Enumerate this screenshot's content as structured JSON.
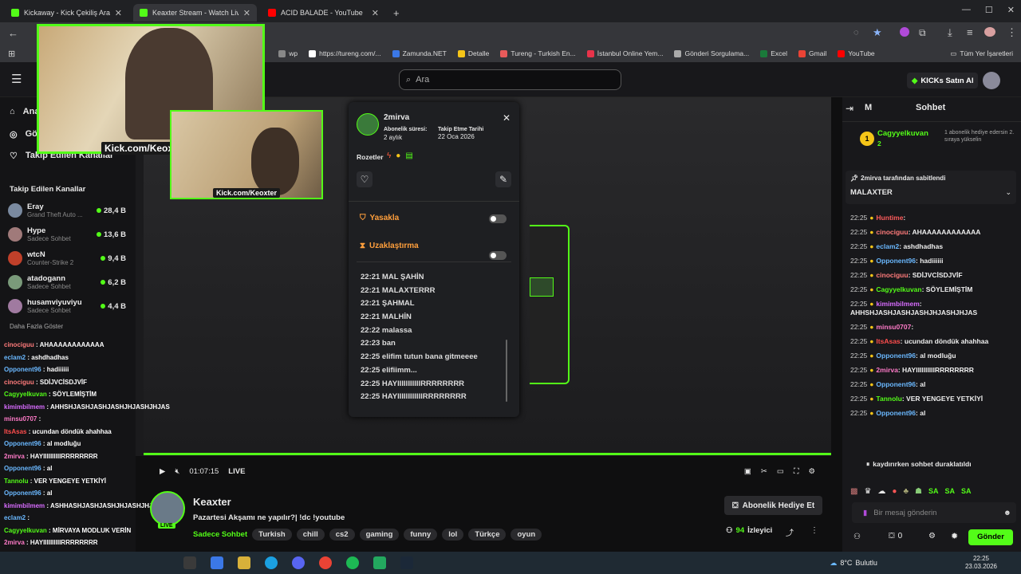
{
  "tabs": [
    {
      "title": "Kickaway - Kick Çekiliş Aracı",
      "color": "#53fc18",
      "active": false
    },
    {
      "title": "Keaxter Stream - Watch Live o",
      "color": "#53fc18",
      "active": true
    },
    {
      "title": "ACID BALADE - YouTube",
      "color": "#ff0000",
      "active": false
    }
  ],
  "bookmarks": [
    "wp",
    "https://tureng.com/...",
    "Zamunda.NET",
    "Detalle",
    "Tureng - Turkish En...",
    "İstanbul Online Yem...",
    "Gönderi Sorgulama...",
    "Excel",
    "Gmail",
    "YouTube"
  ],
  "bookmarks_other": "Tüm Yer İşaretleri",
  "header": {
    "search_placeholder": "Ara",
    "buy_kicks": "KICKs Satın Al"
  },
  "leftnav": {
    "partial1": "Ana",
    "partial2": "Göz",
    "following_link": "Takip Edilen Kanallar",
    "following_title": "Takip Edilen Kanallar",
    "channels": [
      {
        "name": "Eray",
        "sub": "Grand Theft Auto ...",
        "count": "28,4 B"
      },
      {
        "name": "Hype",
        "sub": "Sadece Sohbet",
        "count": "13,6 B"
      },
      {
        "name": "wtcN",
        "sub": "Counter-Strike 2",
        "count": "9,4 B"
      },
      {
        "name": "atadogann",
        "sub": "Sadece Sohbet",
        "count": "6,2 B"
      },
      {
        "name": "husamviyuviyu",
        "sub": "Sadece Sohbet",
        "count": "4,4 B"
      }
    ],
    "more": "Daha Fazla Göster"
  },
  "webcam": {
    "label1": "Kick.com/Keoxter",
    "label2": "Kick.com/Keoxter"
  },
  "popup": {
    "username": "2mirva",
    "sub_label": "Abonelik süresi:",
    "sub_value": "2 aylık",
    "follow_label": "Takip Etme Tarihi",
    "follow_value": "22 Oca 2026",
    "badges_label": "Rozetler",
    "ban_label": "Yasakla",
    "timeout_label": "Uzaklaştırma",
    "messages": [
      "22:21 MAL ŞAHİN",
      "22:21 MALAXTERRR",
      "22:21 ŞAHMAL",
      "22:21 MALHİN",
      "22:22 malassa",
      "22:23 ban",
      "22:25 elifim tutun bana gitmeeee",
      "22:25 elifiimm...",
      "22:25 HAYIIIIIIIIIIIRRRRRRRR",
      "22:25 HAYIIIIIIIIIIIIRRRRRRRR"
    ]
  },
  "player": {
    "time": "01:07:15",
    "live": "LIVE"
  },
  "stream": {
    "streamer": "Keaxter",
    "title": "Pazartesi Akşamı ne yapılır?| !dc !youtube",
    "category": "Sadece Sohbet",
    "tags": [
      "Turkish",
      "chill",
      "cs2",
      "gaming",
      "funny",
      "lol",
      "Türkçe",
      "oyun"
    ],
    "gift_button": "Abonelik Hediye Et",
    "viewers": "94",
    "viewers_label": "İzleyici",
    "live_badge": "LIVE"
  },
  "chat": {
    "title": "Sohbet",
    "left_icon_label": "M",
    "top_gifter": "Cagyyelkuvan",
    "top_gifter_count": "2",
    "top_gifter_desc": "1 abonelik hediye edersin 2. sıraya yükselin",
    "pinned_by": "2mirva tarafından sabitlendi",
    "pinned_text": "MALAXTER",
    "messages": [
      {
        "time": "22:25",
        "user": "Huntime",
        "color": "#ff5b5b",
        "text": ""
      },
      {
        "time": "22:25",
        "user": "cinociguu",
        "color": "#ff7b7b",
        "text": "AHAAAAAAAAAAAA"
      },
      {
        "time": "22:25",
        "user": "eclam2",
        "color": "#6ab8ff",
        "text": "ashdhadhas"
      },
      {
        "time": "22:25",
        "user": "Opponent96",
        "color": "#6ab8ff",
        "text": "hadiiiiii"
      },
      {
        "time": "22:25",
        "user": "cinociguu",
        "color": "#ff7b7b",
        "text": "SDİJVCİSDJVİF"
      },
      {
        "time": "22:25",
        "user": "Cagyyelkuvan",
        "color": "#53fc18",
        "text": "SÖYLEMİŞTİM"
      },
      {
        "time": "22:25",
        "user": "kimimbilmem",
        "color": "#d86cff",
        "text": "AHHSHJASHJASHJASHJHJASHJHJAS"
      },
      {
        "time": "22:25",
        "user": "minsu0707",
        "color": "#ff7ac8",
        "text": ""
      },
      {
        "time": "22:25",
        "user": "ItsAsas",
        "color": "#ff4d4d",
        "text": "ucundan döndük ahahhaa"
      },
      {
        "time": "22:25",
        "user": "Opponent96",
        "color": "#6ab8ff",
        "text": "al modluğu"
      },
      {
        "time": "22:25",
        "user": "2mirva",
        "color": "#ff7ac8",
        "text": "HAYIIIIIIIIIIRRRRRRRR"
      },
      {
        "time": "22:25",
        "user": "Opponent96",
        "color": "#6ab8ff",
        "text": "al"
      },
      {
        "time": "22:25",
        "user": "Tannolu",
        "color": "#53fc18",
        "text": "VER YENGEYE YETKİYİ"
      },
      {
        "time": "22:25",
        "user": "Opponent96",
        "color": "#6ab8ff",
        "text": "al"
      }
    ],
    "paused": "kaydırırken sohbet duraklatıldı",
    "input_placeholder": "Bir mesaj gönderin",
    "send": "Gönder",
    "points": "0",
    "emotes": [
      "SA",
      "SA",
      "SA"
    ]
  },
  "overlay_chat": [
    {
      "user": "cinociguu",
      "color": "#ff7b7b",
      "text": "AHAAAAAAAAAAAA"
    },
    {
      "user": "eclam2",
      "color": "#6ab8ff",
      "text": "ashdhadhas"
    },
    {
      "user": "Opponent96",
      "color": "#6ab8ff",
      "text": "hadiiiiii"
    },
    {
      "user": "cinociguu",
      "color": "#ff7b7b",
      "text": "SDİJVCİSDJVİF"
    },
    {
      "user": "Cagyyelkuvan",
      "color": "#53fc18",
      "text": "SÖYLEMİŞTİM"
    },
    {
      "user": "kimimbilmem",
      "color": "#d86cff",
      "text": "AHHSHJASHJASHJASHJHJASHJHJAS"
    },
    {
      "user": "minsu0707",
      "color": "#ff7ac8",
      "text": ""
    },
    {
      "user": "ItsAsas",
      "color": "#ff4d4d",
      "text": "ucundan döndük ahahhaa"
    },
    {
      "user": "Opponent96",
      "color": "#6ab8ff",
      "text": "al modluğu"
    },
    {
      "user": "2mirva",
      "color": "#ff7ac8",
      "text": "HAYIIIIIIIIIIRRRRRRRR"
    },
    {
      "user": "Opponent96",
      "color": "#6ab8ff",
      "text": "al"
    },
    {
      "user": "Tannolu",
      "color": "#53fc18",
      "text": "VER YENGEYE YETKİYİ"
    },
    {
      "user": "Opponent96",
      "color": "#6ab8ff",
      "text": "al"
    },
    {
      "user": "kimimbilmem",
      "color": "#d86cff",
      "text": "ASHHASHJASHJASHJHJASHJHJAS"
    },
    {
      "user": "eclam2",
      "color": "#6ab8ff",
      "text": ""
    },
    {
      "user": "Cagyyelkuvan",
      "color": "#53fc18",
      "text": "MİRVAYA MODLUK VERİN"
    },
    {
      "user": "2mirva",
      "color": "#ff7ac8",
      "text": "HAYIIIIIIIIIIRRRRRRRR"
    },
    {
      "user": "kimimbilmem",
      "color": "#d86cff",
      "text": "ASHJHAHSHHJASHJASHJHJASHJHJAS"
    },
    {
      "user": "cinociguu",
      "color": "#ff7b7b",
      "text": ""
    }
  ],
  "taskbar": {
    "weather": "8°C",
    "weather_desc": "Bulutlu",
    "time": "22:25",
    "date": "23.03.2026"
  },
  "colors": {
    "accent": "#53fc18"
  }
}
